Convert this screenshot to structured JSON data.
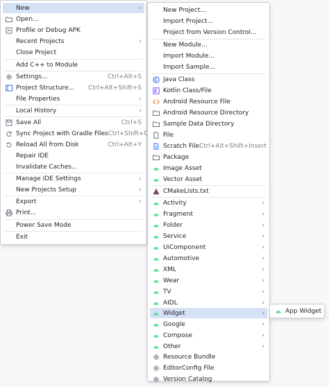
{
  "file_menu": {
    "items": [
      {
        "label": "New",
        "shortcut": "",
        "arrow": "›",
        "icon": "none"
      },
      {
        "label": "Open...",
        "shortcut": "",
        "arrow": "",
        "icon": "folder-icon"
      },
      {
        "label": "Profile or Debug APK",
        "shortcut": "",
        "arrow": "",
        "icon": "profile-icon"
      },
      {
        "label": "Recent Projects",
        "shortcut": "",
        "arrow": "›",
        "icon": "none"
      },
      {
        "label": "Close Project",
        "shortcut": "",
        "arrow": "",
        "icon": "none"
      },
      {
        "label": "Add C++ to Module",
        "shortcut": "",
        "arrow": "",
        "icon": "none"
      },
      {
        "label": "Settings...",
        "shortcut": "Ctrl+Alt+S",
        "arrow": "",
        "icon": "gear-icon"
      },
      {
        "label": "Project Structure...",
        "shortcut": "Ctrl+Alt+Shift+S",
        "arrow": "",
        "icon": "project-structure-icon"
      },
      {
        "label": "File Properties",
        "shortcut": "",
        "arrow": "›",
        "icon": "none"
      },
      {
        "label": "Local History",
        "shortcut": "",
        "arrow": "›",
        "icon": "none"
      },
      {
        "label": "Save All",
        "shortcut": "Ctrl+S",
        "arrow": "",
        "icon": "save-icon"
      },
      {
        "label": "Sync Project with Gradle Files",
        "shortcut": "Ctrl+Shift+O",
        "arrow": "",
        "icon": "gradle-sync-icon"
      },
      {
        "label": "Reload All from Disk",
        "shortcut": "Ctrl+Alt+Y",
        "arrow": "",
        "icon": "reload-icon"
      },
      {
        "label": "Repair IDE",
        "shortcut": "",
        "arrow": "",
        "icon": "none"
      },
      {
        "label": "Invalidate Caches...",
        "shortcut": "",
        "arrow": "",
        "icon": "none"
      },
      {
        "label": "Manage IDE Settings",
        "shortcut": "",
        "arrow": "›",
        "icon": "none"
      },
      {
        "label": "New Projects Setup",
        "shortcut": "",
        "arrow": "›",
        "icon": "none"
      },
      {
        "label": "Export",
        "shortcut": "",
        "arrow": "›",
        "icon": "none"
      },
      {
        "label": "Print...",
        "shortcut": "",
        "arrow": "",
        "icon": "print-icon"
      },
      {
        "label": "Power Save Mode",
        "shortcut": "",
        "arrow": "",
        "icon": "none"
      },
      {
        "label": "Exit",
        "shortcut": "",
        "arrow": "",
        "icon": "none"
      }
    ]
  },
  "new_menu": {
    "items": [
      {
        "label": "New Project...",
        "shortcut": "",
        "arrow": "",
        "icon": "none"
      },
      {
        "label": "Import Project...",
        "shortcut": "",
        "arrow": "",
        "icon": "none"
      },
      {
        "label": "Project from Version Control...",
        "shortcut": "",
        "arrow": "",
        "icon": "none"
      },
      {
        "label": "New Module...",
        "shortcut": "",
        "arrow": "",
        "icon": "none"
      },
      {
        "label": "Import Module...",
        "shortcut": "",
        "arrow": "",
        "icon": "none"
      },
      {
        "label": "Import Sample...",
        "shortcut": "",
        "arrow": "",
        "icon": "none"
      },
      {
        "label": "Java Class",
        "shortcut": "",
        "arrow": "",
        "icon": "java-class-icon"
      },
      {
        "label": "Kotlin Class/File",
        "shortcut": "",
        "arrow": "",
        "icon": "kotlin-icon"
      },
      {
        "label": "Android Resource File",
        "shortcut": "",
        "arrow": "",
        "icon": "resource-file-icon"
      },
      {
        "label": "Android Resource Directory",
        "shortcut": "",
        "arrow": "",
        "icon": "folder-icon"
      },
      {
        "label": "Sample Data Directory",
        "shortcut": "",
        "arrow": "",
        "icon": "folder-icon"
      },
      {
        "label": "File",
        "shortcut": "",
        "arrow": "",
        "icon": "file-icon"
      },
      {
        "label": "Scratch File",
        "shortcut": "Ctrl+Alt+Shift+Insert",
        "arrow": "",
        "icon": "scratch-file-icon"
      },
      {
        "label": "Package",
        "shortcut": "",
        "arrow": "",
        "icon": "folder-icon"
      },
      {
        "label": "Image Asset",
        "shortcut": "",
        "arrow": "",
        "icon": "android-icon"
      },
      {
        "label": "Vector Asset",
        "shortcut": "",
        "arrow": "",
        "icon": "android-icon"
      },
      {
        "label": "CMakeLists.txt",
        "shortcut": "",
        "arrow": "",
        "icon": "cmake-icon"
      },
      {
        "label": "Activity",
        "shortcut": "",
        "arrow": "›",
        "icon": "android-icon"
      },
      {
        "label": "Fragment",
        "shortcut": "",
        "arrow": "›",
        "icon": "android-icon"
      },
      {
        "label": "Folder",
        "shortcut": "",
        "arrow": "›",
        "icon": "android-icon"
      },
      {
        "label": "Service",
        "shortcut": "",
        "arrow": "›",
        "icon": "android-icon"
      },
      {
        "label": "UiComponent",
        "shortcut": "",
        "arrow": "›",
        "icon": "android-icon"
      },
      {
        "label": "Automotive",
        "shortcut": "",
        "arrow": "›",
        "icon": "android-icon"
      },
      {
        "label": "XML",
        "shortcut": "",
        "arrow": "›",
        "icon": "android-icon"
      },
      {
        "label": "Wear",
        "shortcut": "",
        "arrow": "›",
        "icon": "android-icon"
      },
      {
        "label": "TV",
        "shortcut": "",
        "arrow": "›",
        "icon": "android-icon"
      },
      {
        "label": "AIDL",
        "shortcut": "",
        "arrow": "›",
        "icon": "android-icon"
      },
      {
        "label": "Widget",
        "shortcut": "",
        "arrow": "›",
        "icon": "android-icon"
      },
      {
        "label": "Google",
        "shortcut": "",
        "arrow": "›",
        "icon": "android-icon"
      },
      {
        "label": "Compose",
        "shortcut": "",
        "arrow": "›",
        "icon": "android-icon"
      },
      {
        "label": "Other",
        "shortcut": "",
        "arrow": "›",
        "icon": "android-icon"
      },
      {
        "label": "Resource Bundle",
        "shortcut": "",
        "arrow": "",
        "icon": "gear-icon"
      },
      {
        "label": "EditorConfig File",
        "shortcut": "",
        "arrow": "",
        "icon": "gear-icon"
      },
      {
        "label": "Version Catalog",
        "shortcut": "",
        "arrow": "",
        "icon": "gear-icon"
      }
    ]
  },
  "widget_submenu": {
    "items": [
      {
        "label": "App Widget",
        "icon": "app-widget-icon"
      }
    ]
  },
  "colors": {
    "highlight": "#d5e1f5",
    "android_green": "#3ddc84",
    "java_blue": "#3574f0",
    "kotlin_purple": "#7f52ff",
    "resource_orange": "#e9772d"
  }
}
